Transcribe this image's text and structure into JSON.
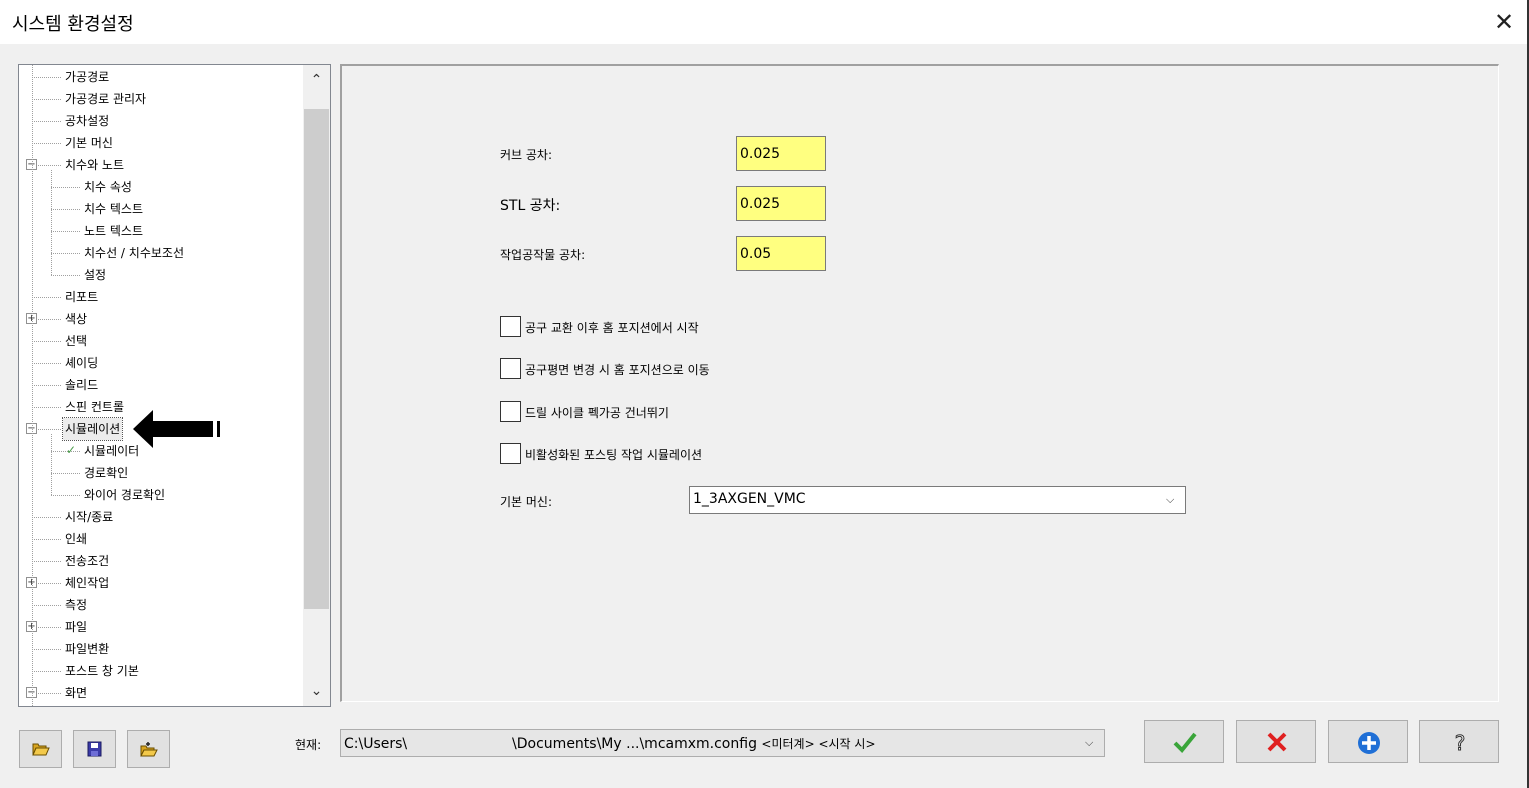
{
  "window": {
    "title": "시스템 환경설정",
    "close_glyph": "✕"
  },
  "tree": {
    "items": [
      {
        "label": "가공경로",
        "level": 0
      },
      {
        "label": "가공경로 관리자",
        "level": 0
      },
      {
        "label": "공차설정",
        "level": 0
      },
      {
        "label": "기본 머신",
        "level": 0
      },
      {
        "label": "치수와 노트",
        "level": 0,
        "expander": "minus"
      },
      {
        "label": "치수 속성",
        "level": 1
      },
      {
        "label": "치수 텍스트",
        "level": 1
      },
      {
        "label": "노트 텍스트",
        "level": 1
      },
      {
        "label": "치수선 / 치수보조선",
        "level": 1
      },
      {
        "label": "설정",
        "level": 1
      },
      {
        "label": "리포트",
        "level": 0
      },
      {
        "label": "색상",
        "level": 0,
        "expander": "plus"
      },
      {
        "label": "선택",
        "level": 0
      },
      {
        "label": "셰이딩",
        "level": 0
      },
      {
        "label": "솔리드",
        "level": 0
      },
      {
        "label": "스핀 컨트롤",
        "level": 0
      },
      {
        "label": "시뮬레이션",
        "level": 0,
        "expander": "minus",
        "selected": true
      },
      {
        "label": "시뮬레이터",
        "level": 1,
        "checked": true
      },
      {
        "label": "경로확인",
        "level": 1
      },
      {
        "label": "와이어 경로확인",
        "level": 1
      },
      {
        "label": "시작/종료",
        "level": 0
      },
      {
        "label": "인쇄",
        "level": 0
      },
      {
        "label": "전송조건",
        "level": 0
      },
      {
        "label": "체인작업",
        "level": 0,
        "expander": "plus"
      },
      {
        "label": "측정",
        "level": 0
      },
      {
        "label": "파일",
        "level": 0,
        "expander": "plus"
      },
      {
        "label": "파일변환",
        "level": 0
      },
      {
        "label": "포스트 창 기본",
        "level": 0
      },
      {
        "label": "화면",
        "level": 0,
        "expander": "minus"
      }
    ]
  },
  "tolerance": {
    "curve_label": "커브 공차:",
    "curve_value": "0.025",
    "stl_label": "STL 공차:",
    "stl_value": "0.025",
    "stock_label": "작업공작물 공차:",
    "stock_value": "0.05"
  },
  "options": [
    {
      "label": "공구 교환 이후 홈 포지션에서 시작",
      "checked": false
    },
    {
      "label": "공구평면 변경 시 홈 포지션으로 이동",
      "checked": false
    },
    {
      "label": "드릴 사이클 펙가공 건너뛰기",
      "checked": false
    },
    {
      "label": "비활성화된 포스팅 작업 시뮬레이션",
      "checked": false
    }
  ],
  "machine": {
    "label": "기본 머신:",
    "value": "1_3AXGEN_VMC"
  },
  "footer": {
    "current_label": "현재:",
    "path_head": "C:\\Users\\",
    "path_middle": "\\Documents\\My ...\\mcamxm.config",
    "path_tail": "<미터계> <시작 시>"
  },
  "colors": {
    "input_yellow": "#ffff80",
    "ok_green": "#3aa53a",
    "cancel_red": "#e02020",
    "add_blue": "#1f6fd6"
  }
}
